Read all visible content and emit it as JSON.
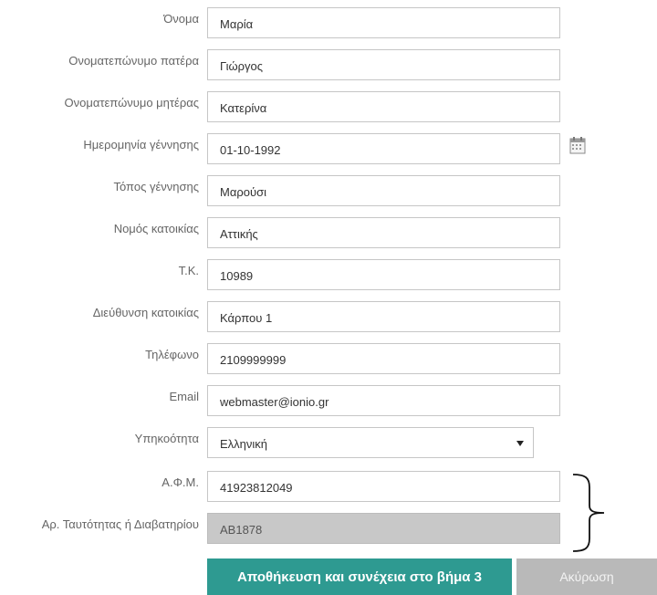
{
  "form": {
    "fields": [
      {
        "label": "Όνομα",
        "value": "Μαρία"
      },
      {
        "label": "Ονοματεπώνυμο πατέρα",
        "value": "Γιώργος"
      },
      {
        "label": "Ονοματεπώνυμο μητέρας",
        "value": "Κατερίνα"
      },
      {
        "label": "Ημερομηνία γέννησης",
        "value": "01-10-1992"
      },
      {
        "label": "Τόπος γέννησης",
        "value": "Μαρούσι"
      },
      {
        "label": "Νομός κατοικίας",
        "value": "Αττικής"
      },
      {
        "label": "Τ.Κ.",
        "value": "10989"
      },
      {
        "label": "Διεύθυνση κατοικίας",
        "value": "Κάρπου 1"
      },
      {
        "label": "Τηλέφωνο",
        "value": "2109999999"
      },
      {
        "label": "Email",
        "value": "webmaster@ionio.gr"
      },
      {
        "label": "Υπηκοότητα",
        "value": "Ελληνική"
      },
      {
        "label": "Α.Φ.Μ.",
        "value": "41923812049"
      },
      {
        "label": "Αρ. Ταυτότητας ή Διαβατηρίου",
        "value": "AB1878"
      }
    ]
  },
  "buttons": {
    "save_label": "Αποθήκευση και συνέχεια στο βήμα 3",
    "cancel_label": "Ακύρωση"
  },
  "icons": {
    "date_picker": "calendar-icon",
    "select_arrow": "caret-down-icon",
    "annotation": "curly-brace-icon"
  },
  "colors": {
    "save_button": "#2e9a91",
    "cancel_button": "#b9b9b9",
    "disabled_field": "#c8c8c8"
  }
}
